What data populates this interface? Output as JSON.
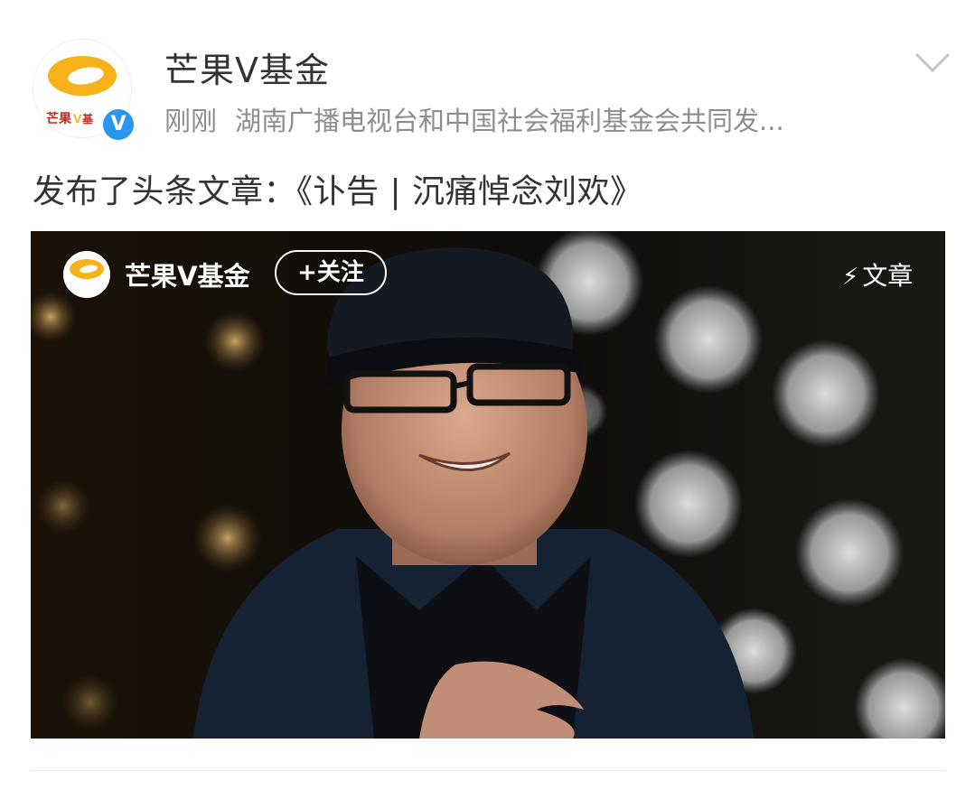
{
  "header": {
    "account_name": "芒果V基金",
    "time": "刚刚",
    "description": "湖南广播电视台和中国社会福利基金会共同发...",
    "verified_badge": "V",
    "avatar_logo_text": "芒果V基金"
  },
  "post": {
    "text": "发布了头条文章：《讣告 | 沉痛悼念刘欢》"
  },
  "card": {
    "account_name": "芒果V基金",
    "follow_label": "+关注",
    "tag_icon": "⚡",
    "tag_label": "文章"
  },
  "colors": {
    "brand_orange": "#f6b21b",
    "verified_blue": "#2a97ee",
    "text_primary": "#333333",
    "text_secondary": "#8d8d8d"
  },
  "icons": [
    "chevron-down-icon",
    "verified-icon",
    "lightning-icon"
  ]
}
